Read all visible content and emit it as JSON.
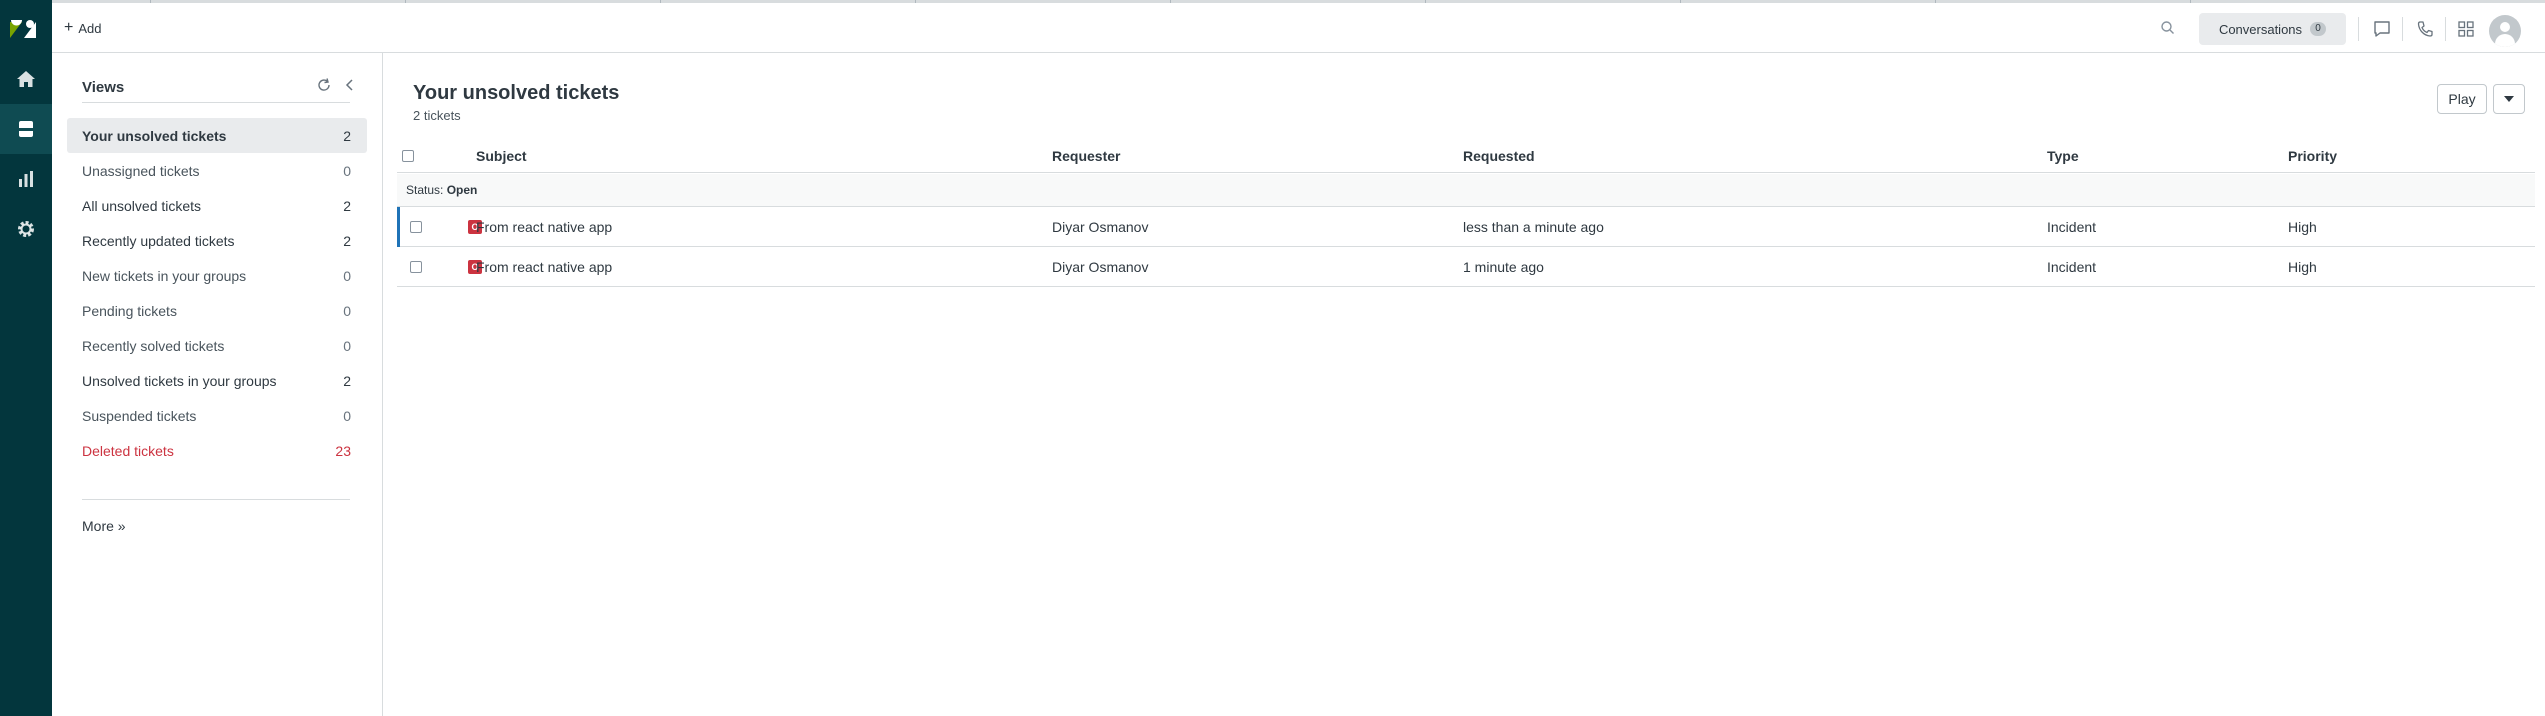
{
  "header": {
    "add_label": "Add",
    "conversations_label": "Conversations",
    "conversations_count": "0"
  },
  "views": {
    "title": "Views",
    "items": [
      {
        "label": "Your unsolved tickets",
        "count": "2"
      },
      {
        "label": "Unassigned tickets",
        "count": "0"
      },
      {
        "label": "All unsolved tickets",
        "count": "2"
      },
      {
        "label": "Recently updated tickets",
        "count": "2"
      },
      {
        "label": "New tickets in your groups",
        "count": "0"
      },
      {
        "label": "Pending tickets",
        "count": "0"
      },
      {
        "label": "Recently solved tickets",
        "count": "0"
      },
      {
        "label": "Unsolved tickets in your groups",
        "count": "2"
      },
      {
        "label": "Suspended tickets",
        "count": "0"
      },
      {
        "label": "Deleted tickets",
        "count": "23"
      }
    ],
    "more_label": "More »"
  },
  "main": {
    "title": "Your unsolved tickets",
    "subtitle": "2 tickets",
    "play_label": "Play",
    "columns": {
      "subject": "Subject",
      "requester": "Requester",
      "requested": "Requested",
      "type": "Type",
      "priority": "Priority"
    },
    "group_label_prefix": "Status:",
    "group_label_value": "Open",
    "rows": [
      {
        "status_letter": "O",
        "subject": "From react native app",
        "requester": "Diyar Osmanov",
        "requested": "less than a minute ago",
        "type": "Incident",
        "priority": "High"
      },
      {
        "status_letter": "O",
        "subject": "From react native app",
        "requester": "Diyar Osmanov",
        "requested": "1 minute ago",
        "type": "Incident",
        "priority": "High"
      }
    ]
  },
  "colors": {
    "rail": "#03363d",
    "accent": "#1f73b7",
    "status_open": "#cc3340",
    "deleted_text": "#cc3340"
  },
  "icons": [
    "zendesk-logo-icon",
    "home-icon",
    "tickets-icon",
    "reporting-icon",
    "settings-icon",
    "search-icon",
    "chat-icon",
    "phone-icon",
    "apps-grid-icon",
    "refresh-icon",
    "collapse-chevron-icon",
    "chevron-down-icon"
  ]
}
